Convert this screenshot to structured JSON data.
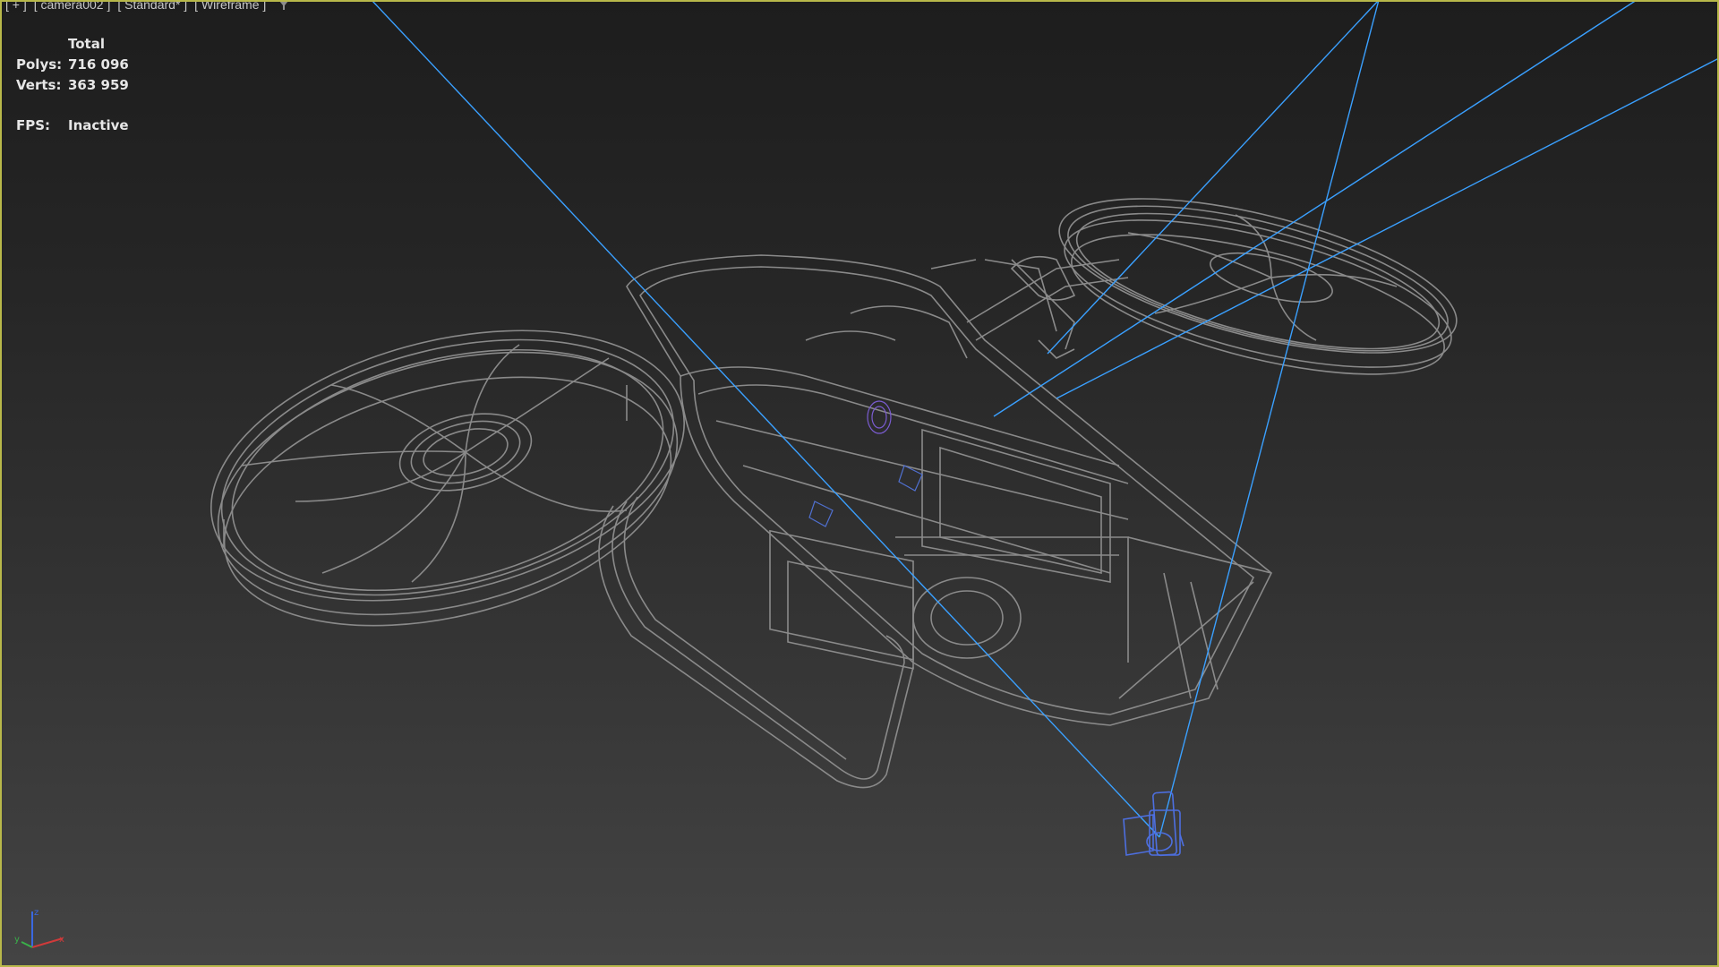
{
  "viewport": {
    "label_plus": "[ + ]",
    "label_camera": "[ camera002 ]",
    "label_shading": "[ Standard* ]",
    "label_mode": "[ Wireframe ]",
    "frame_color": "#b8b84a"
  },
  "stats": {
    "header": "Total",
    "polys_label": "Polys:",
    "polys_value": "716 096",
    "verts_label": "Verts:",
    "verts_value": "363 959",
    "fps_label": "FPS:",
    "fps_value": "Inactive"
  },
  "axis_gizmo": {
    "x_label": "x",
    "y_label": "y",
    "z_label": "z"
  },
  "colors": {
    "wire": "#8a8a8a",
    "camera": "#4d6fe0",
    "target_line": "#3aa0ff"
  },
  "icons": [
    "filter-icon",
    "axis-gizmo-icon",
    "camera-gizmo-icon"
  ]
}
